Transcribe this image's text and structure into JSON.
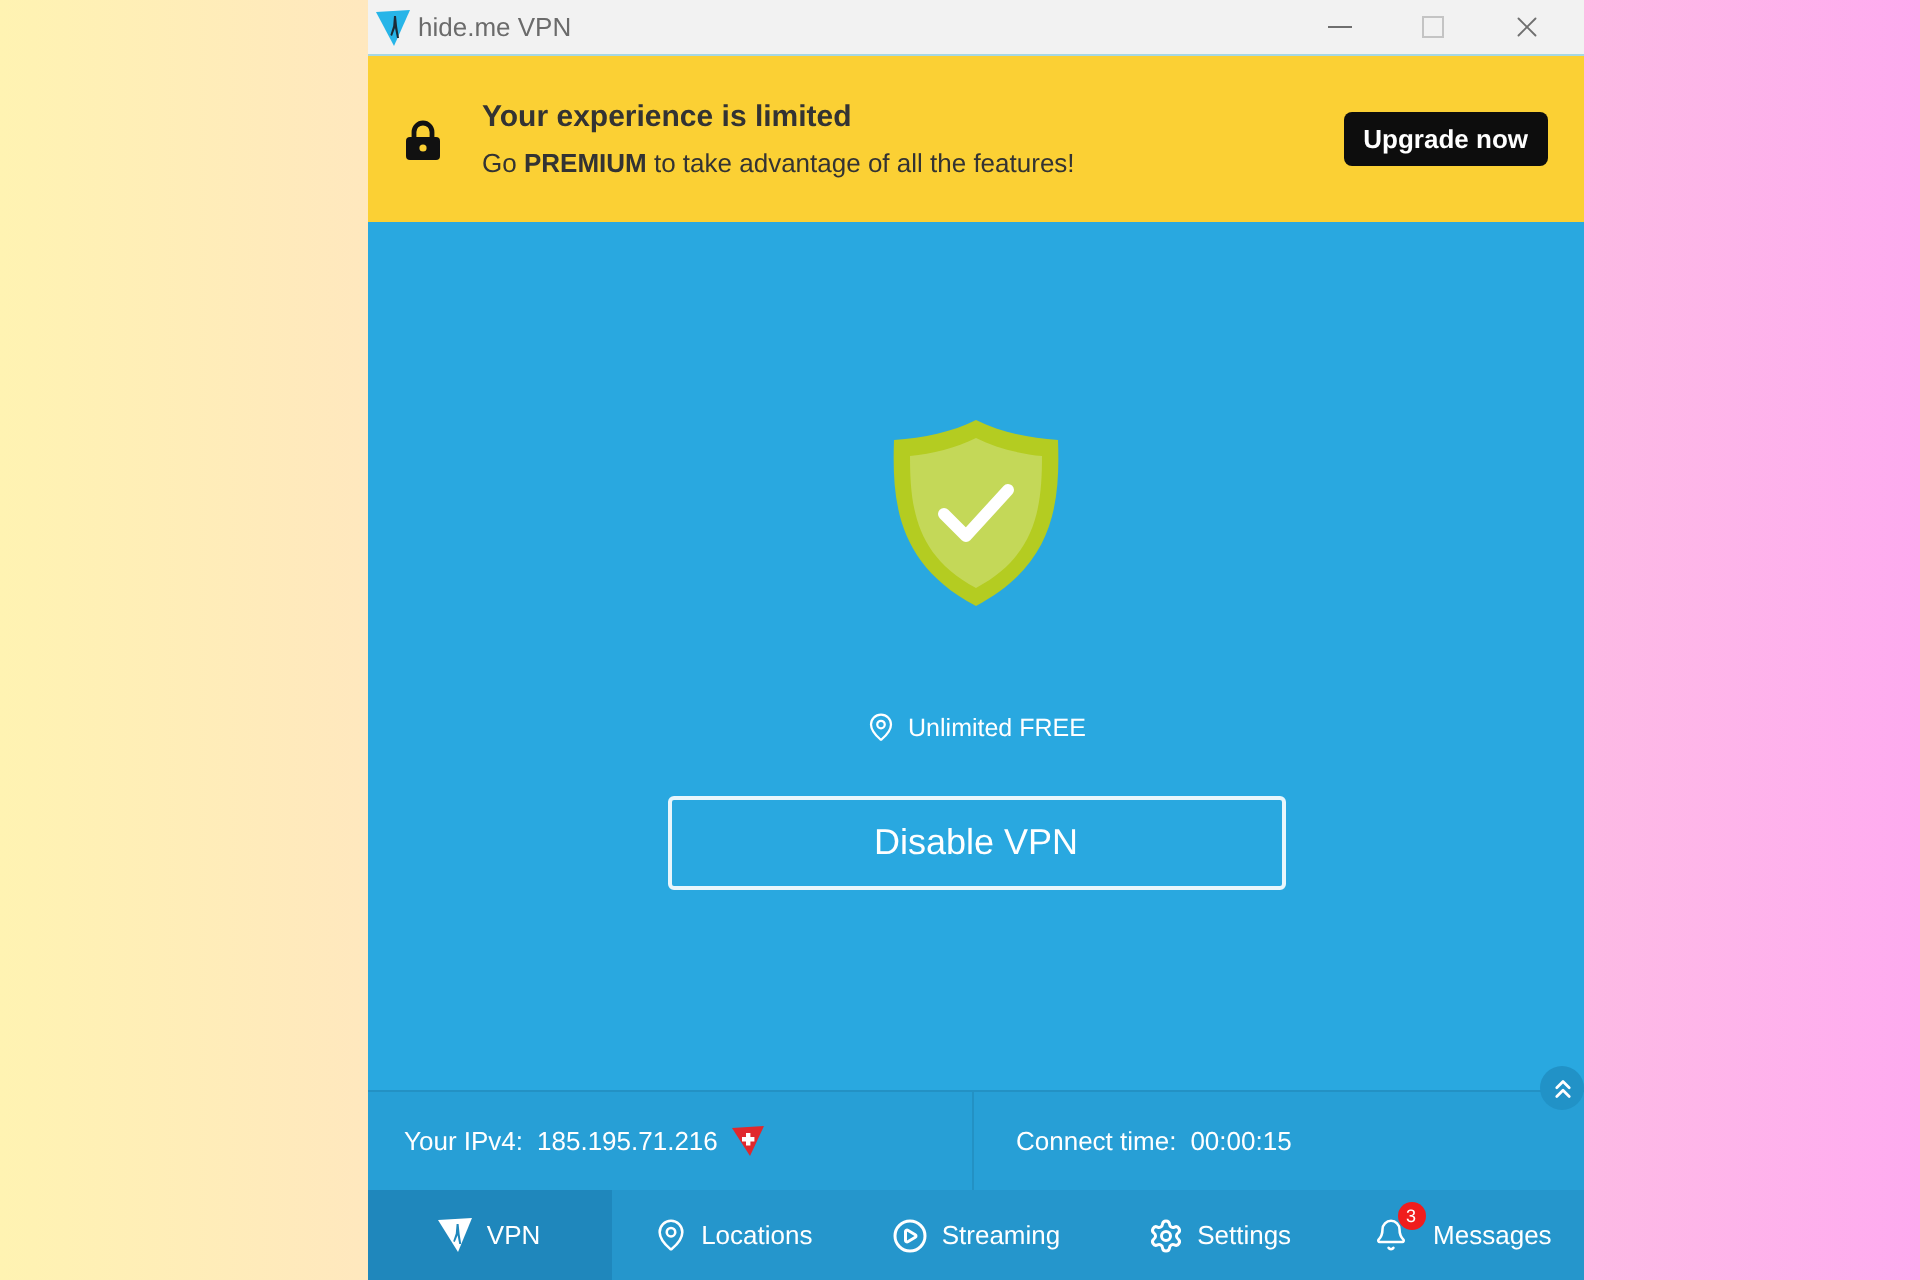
{
  "window": {
    "title": "hide.me VPN"
  },
  "banner": {
    "title": "Your experience is limited",
    "message": "Go **PREMIUM** to take advantage of all the features!",
    "button": "Upgrade now"
  },
  "status": {
    "connected": true,
    "plan": "Unlimited FREE",
    "button": "Disable VPN"
  },
  "info": [
    {
      "label": "Your IPv4:",
      "value": "185.195.71.216"
    },
    {
      "label": "Connect time:",
      "value": "00:00:15"
    }
  ],
  "nav": [
    {
      "label": "VPN",
      "selected": true
    },
    {
      "label": "Locations",
      "selected": false
    },
    {
      "label": "Streaming",
      "selected": false
    },
    {
      "label": "Settings",
      "selected": false
    },
    {
      "label": "Messages",
      "selected": false,
      "badge": "3"
    }
  ]
}
